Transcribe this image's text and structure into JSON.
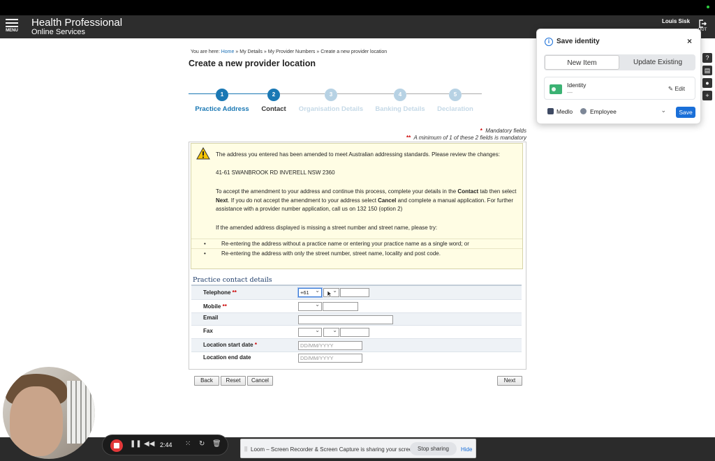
{
  "header": {
    "menu_label": "MENU",
    "brand_line1": "Health Professional",
    "brand_line2": "Online Services",
    "user_name": "Louis Sisk",
    "logout_label": "OUT"
  },
  "breadcrumb": {
    "prefix": "You are here:",
    "home": "Home",
    "sep": "»",
    "my_details": "My Details",
    "provider_numbers": "My Provider Numbers",
    "current": "Create a new provider location"
  },
  "page_title": "Create a new provider location",
  "steps": [
    {
      "num": "1",
      "label": "Practice Address",
      "state": "done"
    },
    {
      "num": "2",
      "label": "Contact",
      "state": "current"
    },
    {
      "num": "3",
      "label": "Organisation Details",
      "state": "future"
    },
    {
      "num": "4",
      "label": "Banking Details",
      "state": "future"
    },
    {
      "num": "5",
      "label": "Declaration",
      "state": "future"
    }
  ],
  "mandatory": {
    "star": "*",
    "double_star": "**",
    "fields_text": "Mandatory fields",
    "min_text": "A minimum of 1 of these 2 fields is mandatory"
  },
  "alert": {
    "intro": "The address you entered has been amended to meet Australian addressing standards. Please review the changes:",
    "address": "41-61 SWANBROOK RD INVERELL NSW 2360",
    "accept_1": "To accept the amendment to your address and continue this process, complete your details in the ",
    "accept_contact": "Contact",
    "accept_2": " tab then select ",
    "accept_next": "Next",
    "accept_3": ". If you do not accept the amendment to your address select ",
    "accept_cancel": "Cancel",
    "accept_4": " and complete a manual application. For further assistance with a provider number application, call us on 132 150 (option 2)",
    "missing": "If the amended address displayed is missing a street number and street name, please try:",
    "bullet1": "Re-entering the address without a practice name or entering your practice name as a single word; or",
    "bullet2": "Re-entering the address with only the street number, street name, locality and post code."
  },
  "contact": {
    "title": "Practice contact details",
    "telephone": "Telephone",
    "mobile": "Mobile",
    "email": "Email",
    "fax": "Fax",
    "start_date": "Location start date",
    "end_date": "Location end date",
    "req_double": "**",
    "req_single": "*",
    "country_code": "+61",
    "date_placeholder": "DD/MM/YYYY"
  },
  "buttons": {
    "back": "Back",
    "reset": "Reset",
    "cancel": "Cancel",
    "next": "Next"
  },
  "popup": {
    "title": "Save identity",
    "info_icon": "i",
    "close": "×",
    "tab_new": "New Item",
    "tab_update": "Update Existing",
    "item_name": "Identity",
    "item_sub": "—",
    "edit_label": "Edit",
    "vault": "Medlo",
    "collection": "Employee",
    "save_label": "Save"
  },
  "side_tools": [
    "?",
    "▤",
    "●",
    "+"
  ],
  "recorder": {
    "time": "2:44"
  },
  "share": {
    "grip": "||",
    "message": "Loom – Screen Recorder & Screen Capture is sharing your screen.",
    "stop_label": "Stop sharing",
    "hide_label": "Hide"
  },
  "colors": {
    "accent_blue": "#1a78b4",
    "alert_bg": "#fffde4",
    "required_red": "#cc0000",
    "header_bg": "#2d2d2d",
    "popup_primary": "#1a6fd8"
  }
}
